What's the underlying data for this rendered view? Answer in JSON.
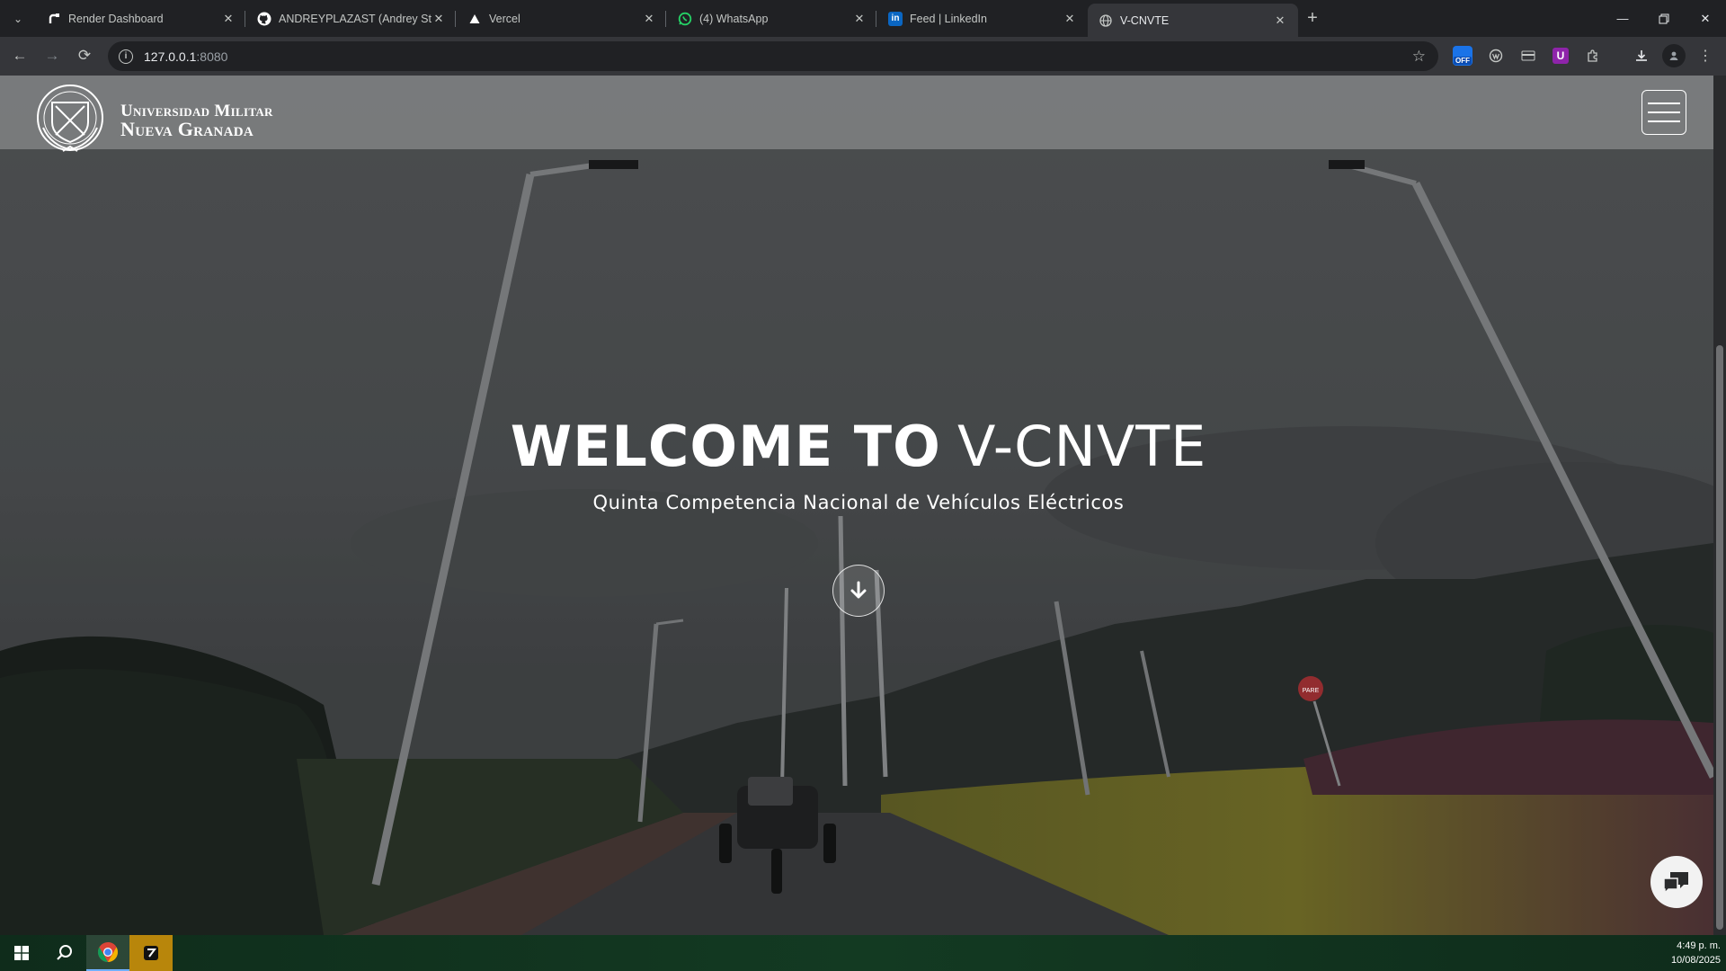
{
  "browser": {
    "tabs": [
      {
        "title": "Render Dashboard",
        "icon": "render-icon",
        "active": false
      },
      {
        "title": "ANDREYPLAZAST (Andrey Steven",
        "icon": "github-icon",
        "active": false
      },
      {
        "title": "Vercel",
        "icon": "vercel-icon",
        "active": false
      },
      {
        "title": "(4) WhatsApp",
        "icon": "whatsapp-icon",
        "active": false
      },
      {
        "title": "Feed | LinkedIn",
        "icon": "linkedin-icon",
        "active": false
      },
      {
        "title": "V-CNVTE",
        "icon": "globe-icon",
        "active": true
      }
    ],
    "close_glyph": "✕",
    "new_tab_glyph": "+",
    "address": {
      "host": "127.0.0.1",
      "port": ":8080"
    },
    "extension_badge": "OFF"
  },
  "site": {
    "logo": {
      "line1": "Universidad Militar",
      "line2": "Nueva Granada"
    },
    "hero": {
      "title_bold": "WELCOME TO",
      "title_light": "V-CNVTE",
      "subtitle": "Quinta Competencia Nacional de Vehículos Eléctricos"
    },
    "street_sign": "PARE"
  },
  "taskbar": {
    "time": "4:49 p. m.",
    "date": "10/08/2025"
  },
  "colors": {
    "chrome_bg": "#202124",
    "toolbar_bg": "#35363a",
    "header_overlay": "#9ea0a2",
    "taskbar": "#133a22"
  }
}
